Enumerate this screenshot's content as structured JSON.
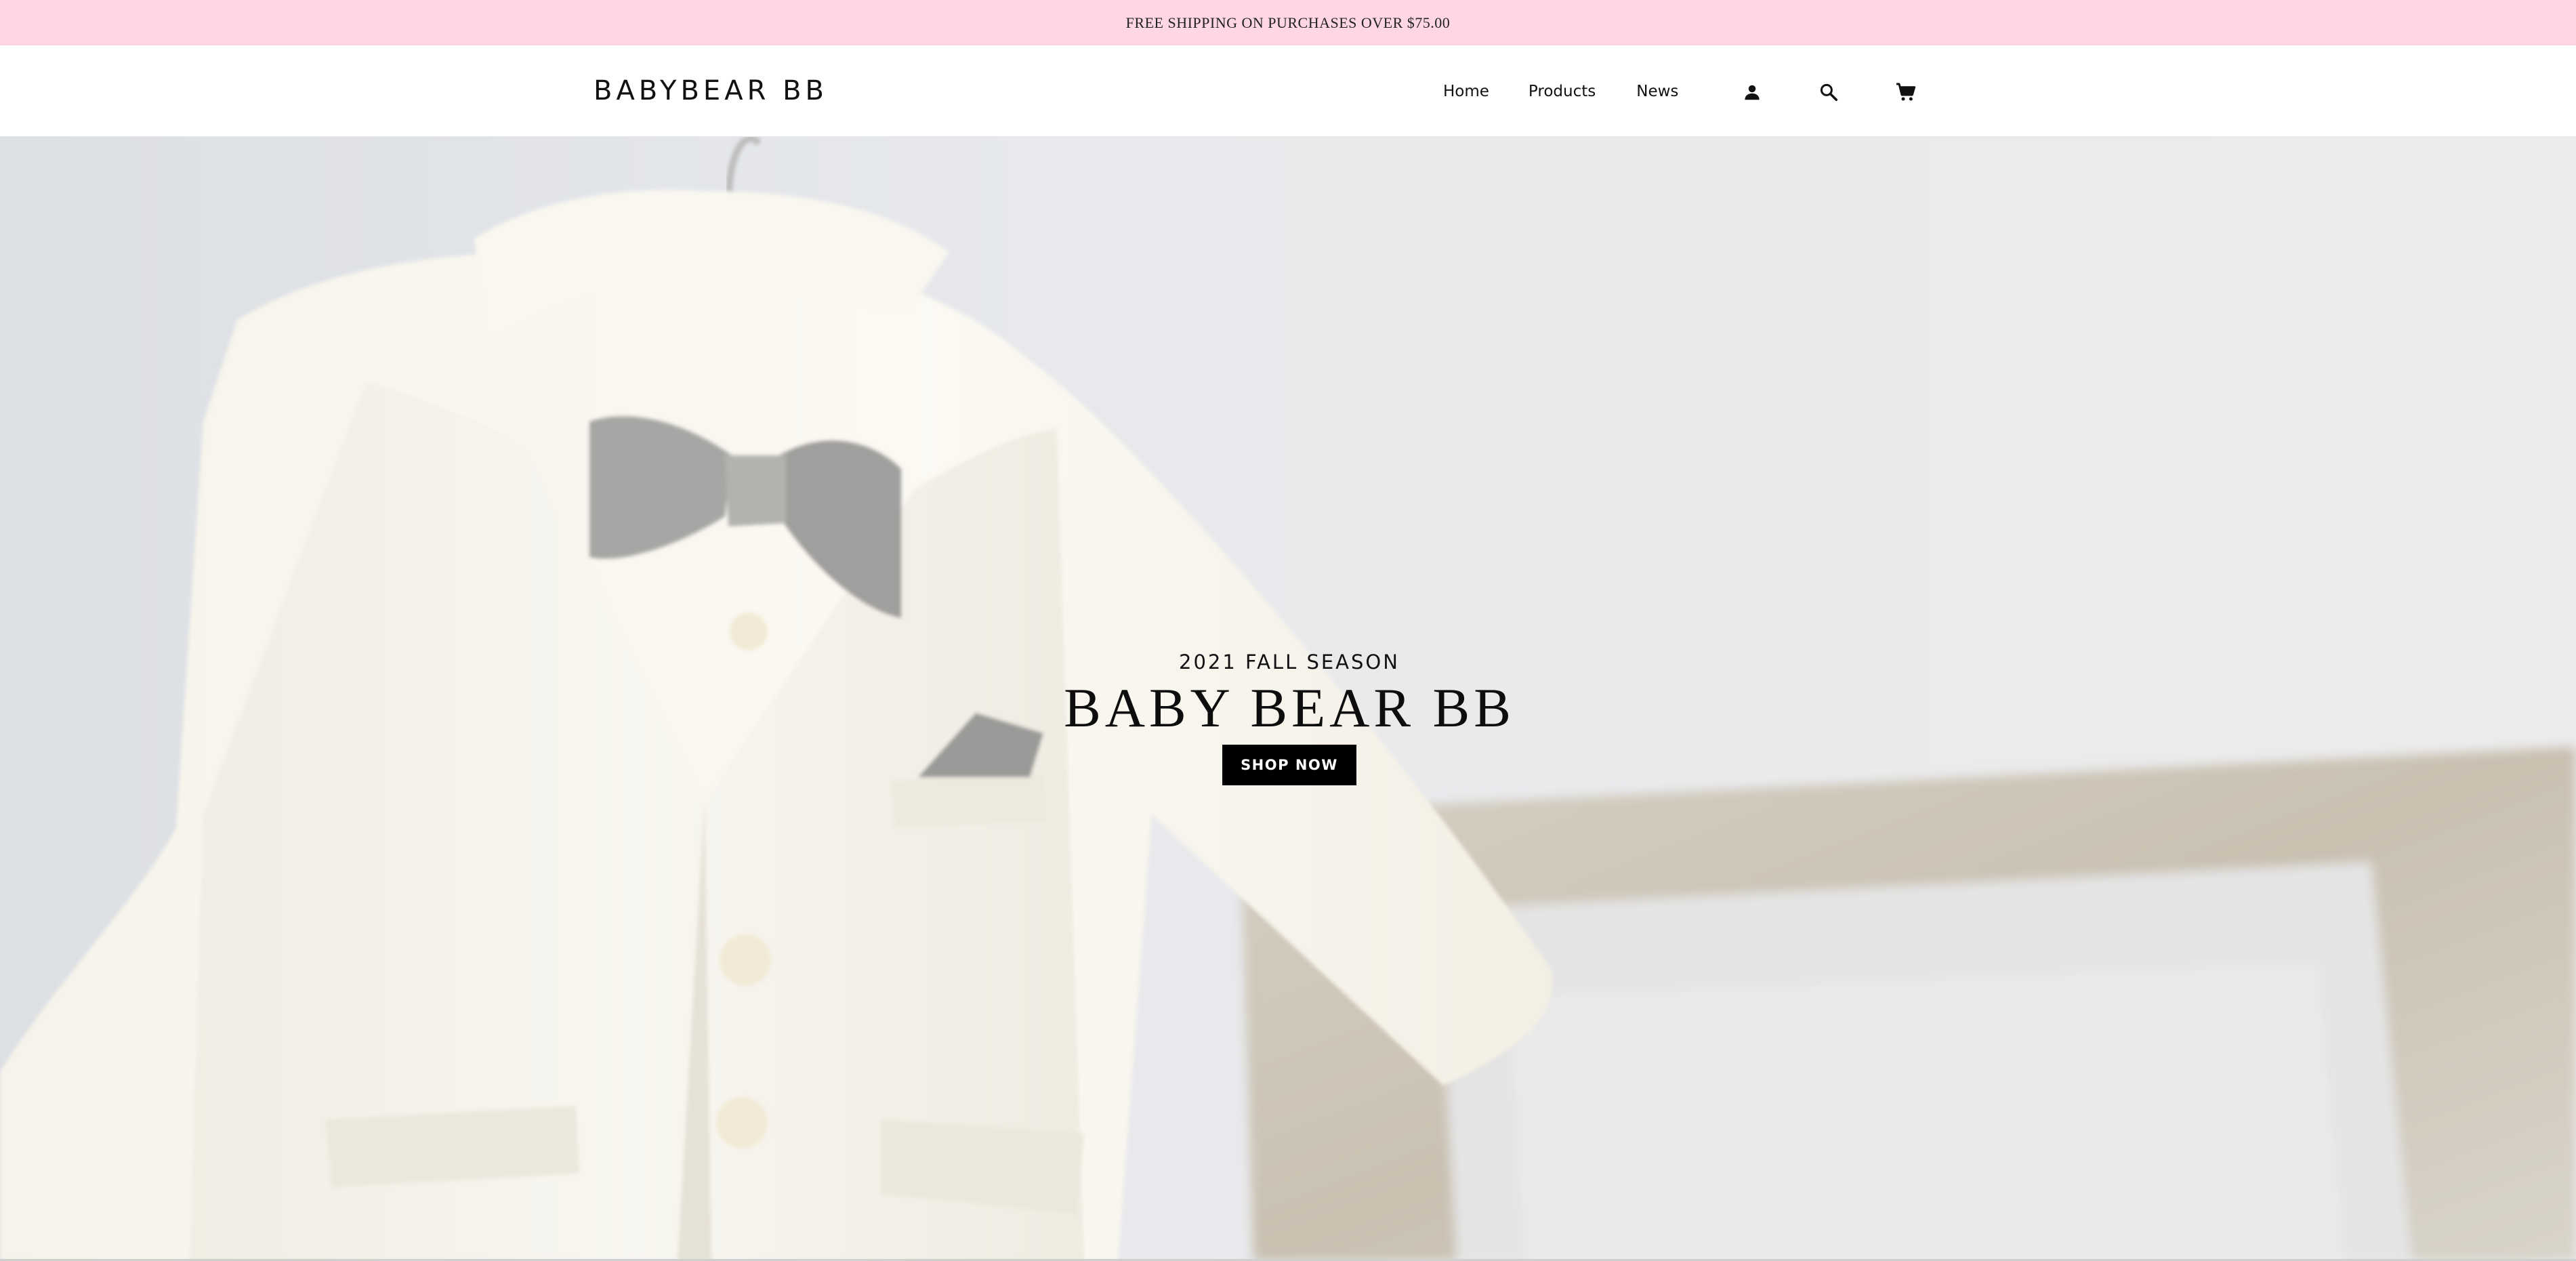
{
  "announcement": {
    "text": "FREE SHIPPING ON PURCHASES OVER $75.00"
  },
  "header": {
    "logo": "BABYBEAR BB",
    "nav": {
      "home": "Home",
      "products": "Products",
      "news": "News"
    },
    "icons": {
      "account": "account-icon",
      "search": "search-icon",
      "cart": "cart-icon"
    }
  },
  "hero": {
    "kicker": "2021 FALL SEASON",
    "title": "BABY BEAR BB",
    "cta": "SHOP NOW"
  },
  "colors": {
    "announcement_bg": "#ffd6e5",
    "cta_bg": "#000000",
    "cta_text": "#ffffff"
  }
}
